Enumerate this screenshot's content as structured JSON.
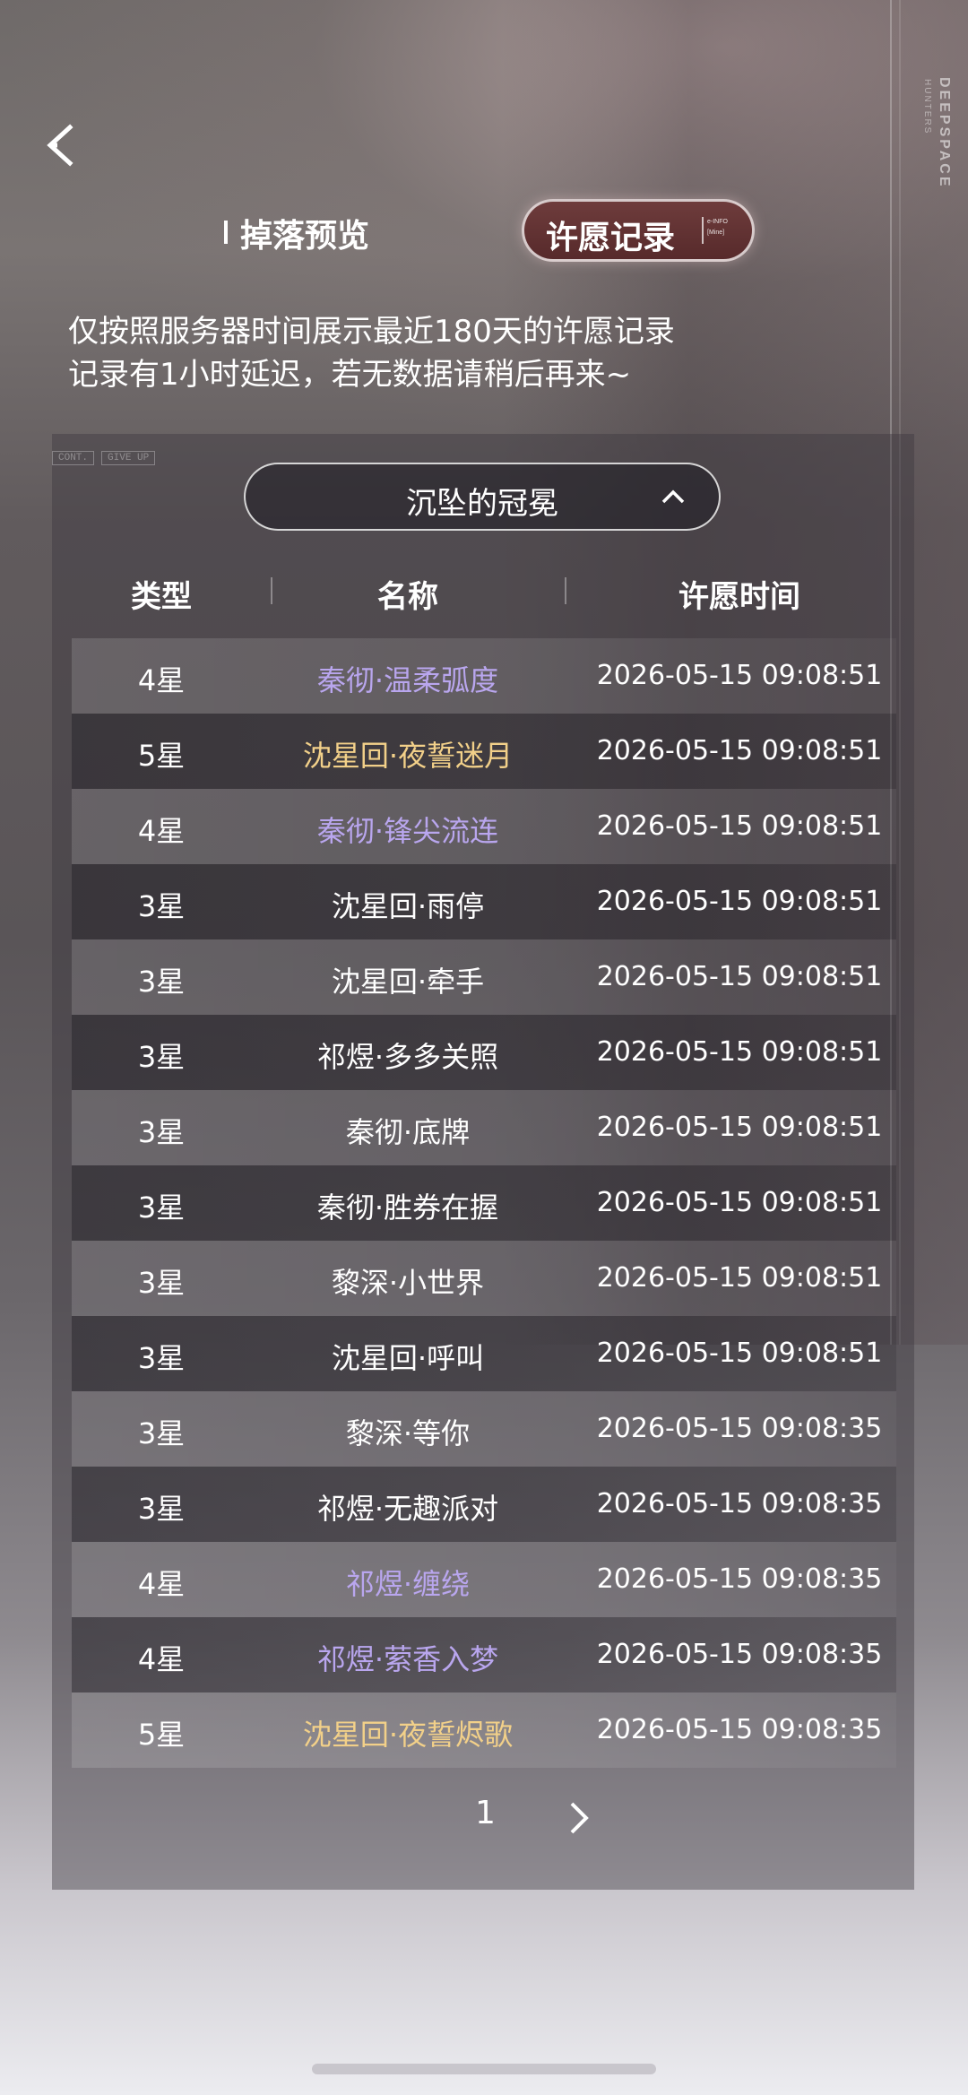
{
  "brand": {
    "title": "DEEPSPACE",
    "subtitle": "HUNTERS"
  },
  "tabs": {
    "drop_preview": "掉落预览",
    "wish_record": "许愿记录",
    "wish_record_deco_top": "e-INFO",
    "wish_record_deco_bottom": "[Mine]"
  },
  "notice": {
    "line1": "仅按照服务器时间展示最近180天的许愿记录",
    "line2": "记录有1小时延迟，若无数据请稍后再来~"
  },
  "panel_deco": {
    "tag1": "CONT.",
    "tag2": "GIVE UP"
  },
  "pool_dropdown": {
    "selected": "沉坠的冠冕"
  },
  "table": {
    "headers": {
      "type": "类型",
      "name": "名称",
      "time": "许愿时间"
    },
    "rows": [
      {
        "type": "4星",
        "name": "秦彻·温柔弧度",
        "time": "2026-05-15 09:08:51",
        "rarity": "4"
      },
      {
        "type": "5星",
        "name": "沈星回·夜誓迷月",
        "time": "2026-05-15 09:08:51",
        "rarity": "5"
      },
      {
        "type": "4星",
        "name": "秦彻·锋尖流连",
        "time": "2026-05-15 09:08:51",
        "rarity": "4"
      },
      {
        "type": "3星",
        "name": "沈星回·雨停",
        "time": "2026-05-15 09:08:51",
        "rarity": "3"
      },
      {
        "type": "3星",
        "name": "沈星回·牵手",
        "time": "2026-05-15 09:08:51",
        "rarity": "3"
      },
      {
        "type": "3星",
        "name": "祁煜·多多关照",
        "time": "2026-05-15 09:08:51",
        "rarity": "3"
      },
      {
        "type": "3星",
        "name": "秦彻·底牌",
        "time": "2026-05-15 09:08:51",
        "rarity": "3"
      },
      {
        "type": "3星",
        "name": "秦彻·胜券在握",
        "time": "2026-05-15 09:08:51",
        "rarity": "3"
      },
      {
        "type": "3星",
        "name": "黎深·小世界",
        "time": "2026-05-15 09:08:51",
        "rarity": "3"
      },
      {
        "type": "3星",
        "name": "沈星回·呼叫",
        "time": "2026-05-15 09:08:51",
        "rarity": "3"
      },
      {
        "type": "3星",
        "name": "黎深·等你",
        "time": "2026-05-15 09:08:35",
        "rarity": "3"
      },
      {
        "type": "3星",
        "name": "祁煜·无趣派对",
        "time": "2026-05-15 09:08:35",
        "rarity": "3"
      },
      {
        "type": "4星",
        "name": "祁煜·缠绕",
        "time": "2026-05-15 09:08:35",
        "rarity": "4"
      },
      {
        "type": "4星",
        "name": "祁煜·萦香入梦",
        "time": "2026-05-15 09:08:35",
        "rarity": "4"
      },
      {
        "type": "5星",
        "name": "沈星回·夜誓烬歌",
        "time": "2026-05-15 09:08:35",
        "rarity": "5"
      }
    ]
  },
  "pagination": {
    "current_page": "1"
  },
  "colors": {
    "rarity_3": "#ffffff",
    "rarity_4": "#b9a6ee",
    "rarity_5": "#f2d089",
    "active_tab_bg": "#5e2f30"
  },
  "icons": {
    "back": "back-chevron-icon",
    "dropdown": "chevron-up-icon",
    "next": "chevron-right-icon"
  }
}
